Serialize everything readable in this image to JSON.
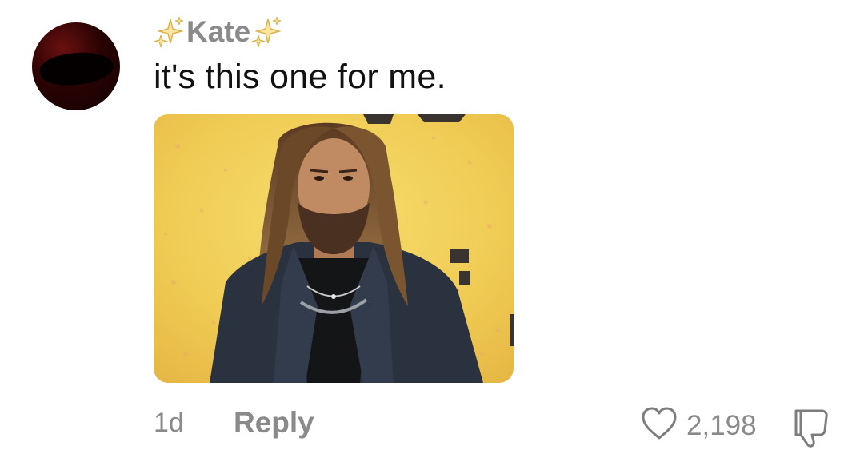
{
  "comment": {
    "username": "Kate",
    "text": "it's this one for me.",
    "time": "1d",
    "reply_label": "Reply",
    "like_count": "2,198"
  },
  "icons": {
    "like": "heart-icon",
    "dislike": "thumbs-down-icon",
    "decoration": "sparkles-icon"
  },
  "colors": {
    "muted_text": "#8a8a8a",
    "body_text": "#111111",
    "sparkle": "#f2c94c"
  }
}
